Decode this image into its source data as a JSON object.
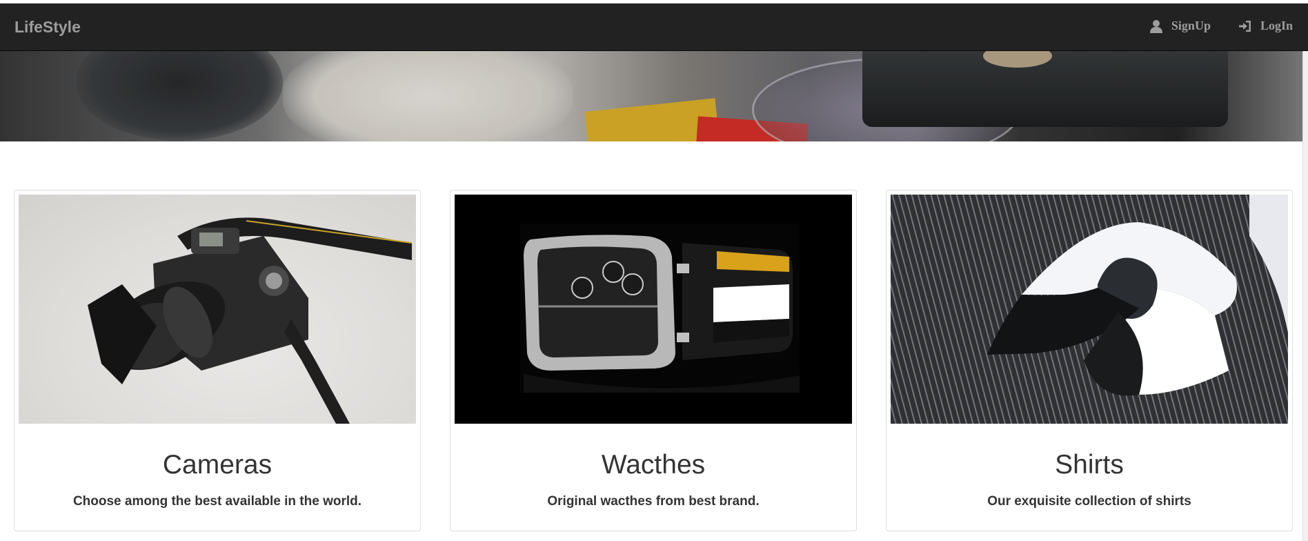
{
  "navbar": {
    "brand": "LifeStyle",
    "links": [
      {
        "label": "SignUp",
        "icon": "user-icon"
      },
      {
        "label": "LogIn",
        "icon": "login-icon"
      }
    ]
  },
  "banner": {
    "description_icon": "banner-image"
  },
  "products": [
    {
      "title": "Cameras",
      "description": "Choose among the best available in the world.",
      "image": "camera-image"
    },
    {
      "title": "Wacthes",
      "description": "Original wacthes from best brand.",
      "image": "watch-image"
    },
    {
      "title": "Shirts",
      "description": "Our exquisite collection of shirts",
      "image": "shirt-image"
    }
  ],
  "colors": {
    "navbar": "#222222",
    "nav_text": "#9d9d9d",
    "text": "#333333",
    "card_border": "#dddddd"
  }
}
